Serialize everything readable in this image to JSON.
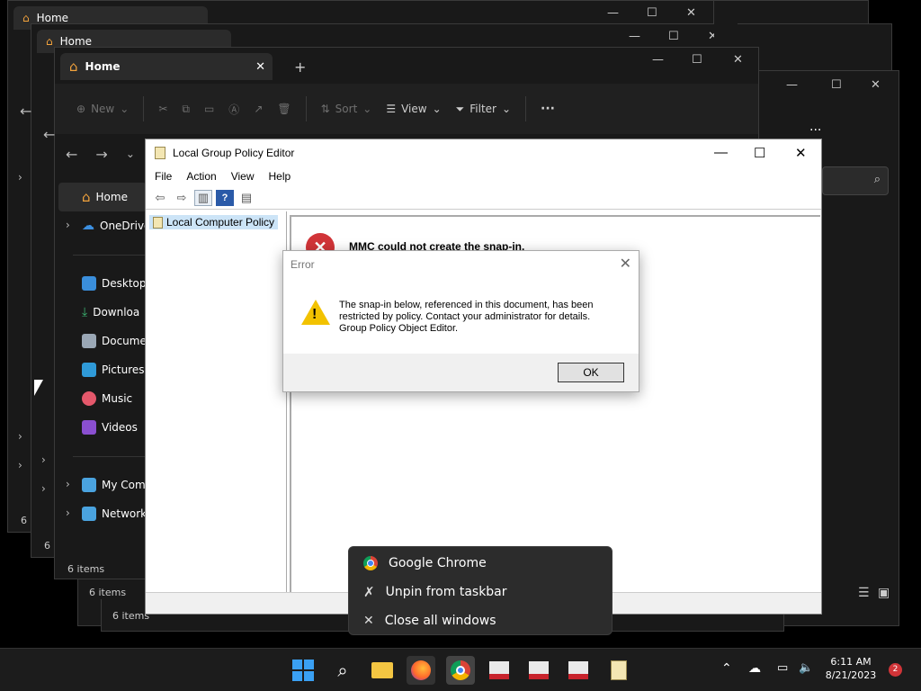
{
  "explorer": {
    "tab_title": "Home",
    "new_label": "New",
    "sort_label": "Sort",
    "view_label": "View",
    "filter_label": "Filter",
    "more_label": "···",
    "sidebar": {
      "home": "Home",
      "onedrive": "OneDrive",
      "desktop": "Desktop",
      "downloads": "Downloa",
      "documents": "Documer",
      "pictures": "Pictures",
      "music": "Music",
      "videos": "Videos",
      "mycomputer": "My Com",
      "network": "Network"
    },
    "status": "6 items",
    "status_bg1": "6 items",
    "status_bg2": "6 items",
    "status_left1": "6 i",
    "status_left2": "6 i"
  },
  "gpe": {
    "title": "Local Group Policy Editor",
    "menu": [
      "File",
      "Action",
      "View",
      "Help"
    ],
    "tree_root": "Local Computer Policy",
    "snapin_error": "MMC could not create the snap-in."
  },
  "error_dialog": {
    "title": "Error",
    "line1": "The snap-in below, referenced in this document, has been",
    "line2": "restricted by policy. Contact your administrator for details.",
    "line3": "Group Policy Object Editor.",
    "ok_label": "OK"
  },
  "context_menu": {
    "items": [
      "Google Chrome",
      "Unpin from taskbar",
      "Close all windows"
    ]
  },
  "taskbar": {
    "time": "6:11 AM",
    "date": "8/21/2023",
    "notifications": "2"
  },
  "colors": {
    "accent_blue": "#0078d4",
    "chrome_red": "#db4437",
    "error_red": "#d13438",
    "warning_yellow": "#f2c200"
  }
}
